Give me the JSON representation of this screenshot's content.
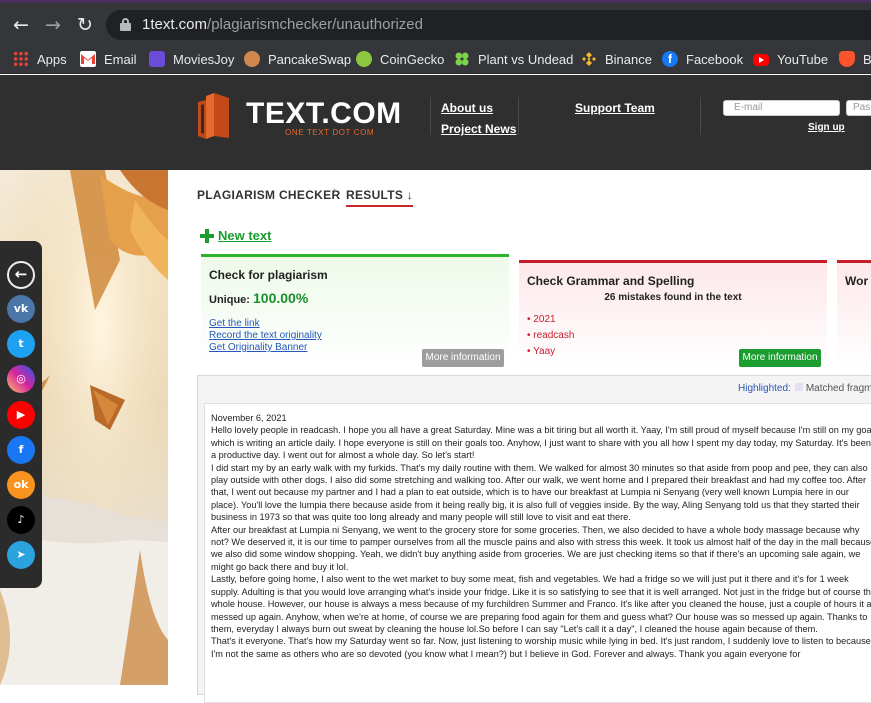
{
  "browser": {
    "url_host": "1text.com",
    "url_path": "/plagiarismchecker/unauthorized",
    "back_glyph": "←",
    "forward_glyph": "→",
    "reload_glyph": "↻"
  },
  "bookmarks": [
    {
      "label": "Apps",
      "icon": "apps-grid-icon"
    },
    {
      "label": "Email",
      "icon": "gmail-icon"
    },
    {
      "label": "MoviesJoy",
      "icon": "moviesjoy-icon"
    },
    {
      "label": "PancakeSwap",
      "icon": "pancakeswap-icon"
    },
    {
      "label": "CoinGecko",
      "icon": "coingecko-icon"
    },
    {
      "label": "Plant vs Undead",
      "icon": "clover-icon"
    },
    {
      "label": "Binance",
      "icon": "binance-icon"
    },
    {
      "label": "Facebook",
      "icon": "facebook-icon"
    },
    {
      "label": "YouTube",
      "icon": "youtube-icon"
    },
    {
      "label": "Be",
      "icon": "brave-icon"
    }
  ],
  "header": {
    "logo_text": "TEXT.COM",
    "logo_sub": "ONE TEXT DOT COM",
    "about": "About us",
    "news": "Project News",
    "support": "Support Team",
    "email_placeholder": "E-mail",
    "pass_placeholder": "Pas",
    "signup": "Sign up"
  },
  "breadcrumb": {
    "first": "PLAGIARISM CHECKER",
    "separator": "›",
    "second": "RESULTS ↓"
  },
  "new_text": "New text",
  "cards": {
    "plagiarism": {
      "title": "Check for plagiarism",
      "unique_label": "Unique:",
      "unique_value": "100.00%",
      "links": [
        "Get the link",
        "Record the text originality",
        "Get Originality Banner"
      ],
      "more": "More information"
    },
    "grammar": {
      "title": "Check Grammar and Spelling",
      "summary": "26 mistakes found in the text",
      "errors": [
        "• 2021",
        "• readcash",
        "• Yaay"
      ],
      "more": "More information"
    },
    "third_title": "Wor"
  },
  "panel": {
    "highlighted": "Highlighted:",
    "matched": "Matched fragme",
    "text": [
      "November 6, 2021",
      "Hello lovely people in readcash. I hope you all have a great Saturday. Mine was a bit tiring but all worth it. Yaay, I'm still proud of myself because I'm still on my goal which is writing an article daily. I hope everyone is still on their goals too. Anyhow, I just want to share with you all how I spent my day today, my Saturday. It's been a productive day. I went out for almost a whole day. So let's start!",
      "I did start my by an early walk with my furkids. That's my daily routine with them. We walked for almost 30 minutes so that aside from poop and pee, they can also play outside with other dogs. I also did some stretching and walking too. After our walk, we went home and I prepared their breakfast and had my coffee too. After that, I went out because my partner and I had a plan to eat outside, which is to have our breakfast at Lumpia ni Senyang (very well known Lumpia here in our place). You'll love the lumpia there because aside from it being really big, it is also full of veggies inside. By the way, Aling Senyang told us that they started their business in 1973 so that was quite too long already and many people will still love to visit and eat there.",
      "After our breakfast at Lumpia ni Senyang, we went to the grocery store for some groceries. Then, we also decided to have a whole body massage because why not? We deserved it, it is our time to pamper ourselves from all the muscle pains and also with stress this week. It took us almost half of the day in the mall because we also did some window shopping. Yeah, we didn't buy anything aside from groceries. We are just checking items so that if there's an upcoming sale again, we might go back there and buy it lol.",
      "Lastly, before going home, I also went to the wet market to buy some meat, fish and vegetables. We had a fridge so we will just put it there and it's for 1 week supply. Adulting is that you would love arranging what's inside your fridge. Like it is so satisfying to see that it is well arranged. Not just in the fridge but of course the whole house. However, our house is always a mess because of my furchildren Summer and Franco. It's like after you cleaned the house, just a couple of hours it all messed up again. Anyhow, when we're at home, of course we are preparing food again for them and guess what? Our house was so messed up again. Thanks to them, everyday I always burn out sweat by cleaning the house lol.So before I can say \"Let's call it a day\", I cleaned the house again because of them.",
      "That's it everyone. That's how my Saturday went so far. Now, just listening to worship music while lying in bed. It's just random, I suddenly love to listen to because I'm not the same as others who are so devoted (you know what I mean?) but I believe in God. Forever and always. Thank you again everyone for"
    ]
  },
  "social": [
    {
      "name": "back-circle-icon",
      "glyph": "←",
      "color": ""
    },
    {
      "name": "vk-icon",
      "glyph": "vk",
      "color": "#4a76a8"
    },
    {
      "name": "twitter-icon",
      "glyph": "t",
      "color": "#1da1f2"
    },
    {
      "name": "instagram-icon",
      "glyph": "◎",
      "color": "#d6249f"
    },
    {
      "name": "youtube-icon",
      "glyph": "▶",
      "color": "#ff0000"
    },
    {
      "name": "facebook-icon",
      "glyph": "f",
      "color": "#1877f2"
    },
    {
      "name": "odnoklassniki-icon",
      "glyph": "ok",
      "color": "#f7931e"
    },
    {
      "name": "tiktok-icon",
      "glyph": "♪",
      "color": "#000000"
    },
    {
      "name": "telegram-icon",
      "glyph": "➤",
      "color": "#2aa3df"
    }
  ],
  "colors": {
    "accent_green": "#1a9c2e",
    "accent_red": "#c71e2c",
    "logo_orange": "#e36a2b",
    "header_bg": "#2f2f2f",
    "link_blue": "#2558b8"
  }
}
